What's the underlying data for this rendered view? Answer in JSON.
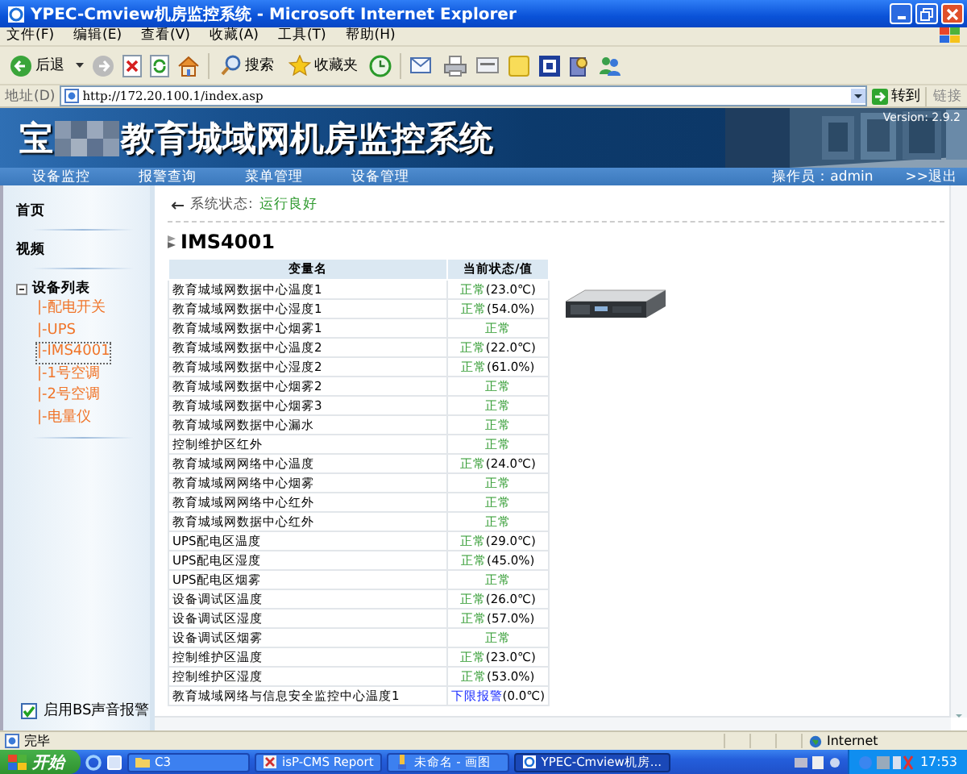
{
  "window": {
    "title": "YPEC-Cmview机房监控系统 - Microsoft Internet Explorer"
  },
  "menu": [
    "文件(F)",
    "编辑(E)",
    "查看(V)",
    "收藏(A)",
    "工具(T)",
    "帮助(H)"
  ],
  "toolbar": {
    "back": "后退",
    "search": "搜索",
    "favorites": "收藏夹"
  },
  "address_bar": {
    "label": "地址(D)",
    "url": "http://172.20.100.1/index.asp",
    "go": "转到",
    "links": "链接"
  },
  "banner": {
    "title_start": "宝",
    "title_rest": "教育城域网机房监控系统",
    "version": "Version: 2.9.2"
  },
  "nav": {
    "items": [
      "设备监控",
      "报警查询",
      "菜单管理",
      "设备管理"
    ],
    "operator": "操作员：admin",
    "logout": ">>退出"
  },
  "sidebar": {
    "items": [
      "首页",
      "视频"
    ],
    "tree": {
      "label": "设备列表",
      "expanded": true,
      "children": [
        {
          "label": "|-配电开关",
          "selected": false
        },
        {
          "label": "|-UPS",
          "selected": false
        },
        {
          "label": "|-IMS4001",
          "selected": true
        },
        {
          "label": "|-1号空调",
          "selected": false
        },
        {
          "label": "|-2号空调",
          "selected": false
        },
        {
          "label": "|-电量仪",
          "selected": false
        }
      ]
    },
    "sound_alarm": {
      "label": "启用BS声音报警",
      "checked": true
    }
  },
  "content": {
    "status_label": "系统状态:",
    "status_value": "运行良好",
    "device": "IMS4001",
    "table": {
      "columns": [
        "变量名",
        "当前状态/值"
      ],
      "rows": [
        {
          "name": "教育城域网数据中心温度1",
          "kind": "normal",
          "status": "正常",
          "value": "(23.0℃)"
        },
        {
          "name": "教育城域网数据中心湿度1",
          "kind": "normal",
          "status": "正常",
          "value": "(54.0%)"
        },
        {
          "name": "教育城域网数据中心烟雾1",
          "kind": "normal",
          "status": "正常"
        },
        {
          "name": "教育城域网数据中心温度2",
          "kind": "normal",
          "status": "正常",
          "value": "(22.0℃)"
        },
        {
          "name": "教育城域网数据中心湿度2",
          "kind": "normal",
          "status": "正常",
          "value": "(61.0%)"
        },
        {
          "name": "教育城域网数据中心烟雾2",
          "kind": "normal",
          "status": "正常"
        },
        {
          "name": "教育城域网数据中心烟雾3",
          "kind": "normal",
          "status": "正常"
        },
        {
          "name": "教育城域网数据中心漏水",
          "kind": "normal",
          "status": "正常"
        },
        {
          "name": "控制维护区红外",
          "kind": "normal",
          "status": "正常"
        },
        {
          "name": "教育城域网网络中心温度",
          "kind": "normal",
          "status": "正常",
          "value": "(24.0℃)"
        },
        {
          "name": "教育城域网网络中心烟雾",
          "kind": "normal",
          "status": "正常"
        },
        {
          "name": "教育城域网网络中心红外",
          "kind": "normal",
          "status": "正常"
        },
        {
          "name": "教育城域网数据中心红外",
          "kind": "normal",
          "status": "正常"
        },
        {
          "name": "UPS配电区温度",
          "kind": "normal",
          "status": "正常",
          "value": "(29.0℃)"
        },
        {
          "name": "UPS配电区湿度",
          "kind": "normal",
          "status": "正常",
          "value": "(45.0%)"
        },
        {
          "name": "UPS配电区烟雾",
          "kind": "normal",
          "status": "正常"
        },
        {
          "name": "设备调试区温度",
          "kind": "normal",
          "status": "正常",
          "value": "(26.0℃)"
        },
        {
          "name": "设备调试区湿度",
          "kind": "normal",
          "status": "正常",
          "value": "(57.0%)"
        },
        {
          "name": "设备调试区烟雾",
          "kind": "normal",
          "status": "正常"
        },
        {
          "name": "控制维护区温度",
          "kind": "normal",
          "status": "正常",
          "value": "(23.0℃)"
        },
        {
          "name": "控制维护区湿度",
          "kind": "normal",
          "status": "正常",
          "value": "(53.0%)"
        },
        {
          "name": "教育城域网络与信息安全监控中心温度1",
          "kind": "alarm",
          "status": "下限报警",
          "value": "(0.0℃)"
        }
      ]
    }
  },
  "status_bar": {
    "text": "完毕",
    "zone": "Internet"
  },
  "taskbar": {
    "start": "开始",
    "tasks": [
      {
        "label": "C3",
        "kind": "folder",
        "selected": false
      },
      {
        "label": "isP-CMS Report",
        "kind": "app",
        "selected": false
      },
      {
        "label": "未命名 - 画图",
        "kind": "paint",
        "selected": false
      },
      {
        "label": "YPEC-Cmview机房...",
        "kind": "browser",
        "selected": true
      }
    ],
    "clock": "17:53"
  }
}
